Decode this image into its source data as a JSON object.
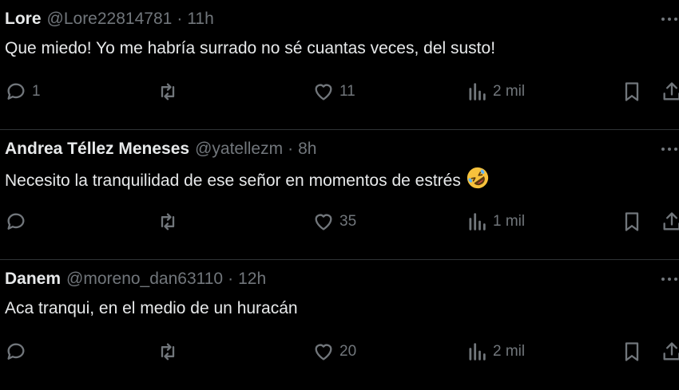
{
  "tweets": [
    {
      "name": "Lore",
      "handle": "@Lore22814781",
      "separator": "·",
      "time": "11h",
      "text": "Que miedo! Yo me habría surrado no sé cuantas veces, del susto!",
      "emoji": "",
      "replies": "1",
      "retweets": "",
      "likes": "11",
      "views": "2 mil"
    },
    {
      "name": "Andrea Téllez Meneses",
      "handle": "@yatellezm",
      "separator": "·",
      "time": "8h",
      "text": "Necesito la tranquilidad de ese señor en momentos de estrés",
      "emoji": "rolling-on-floor-laughing",
      "replies": "",
      "retweets": "",
      "likes": "35",
      "views": "1 mil"
    },
    {
      "name": "Danem",
      "handle": "@moreno_dan63110",
      "separator": "·",
      "time": "12h",
      "text": "Aca tranqui, en el medio de un huracán",
      "emoji": "",
      "replies": "",
      "retweets": "",
      "likes": "20",
      "views": "2 mil"
    }
  ],
  "icons": {
    "more": "more-dots-icon",
    "reply": "reply-bubble-icon",
    "retweet": "retweet-icon",
    "like": "heart-icon",
    "views": "views-chart-icon",
    "bookmark": "bookmark-icon",
    "share": "share-icon"
  },
  "colors": {
    "background": "#000000",
    "text": "#e7e9ea",
    "muted": "#71767b",
    "divider": "#2f3336"
  }
}
